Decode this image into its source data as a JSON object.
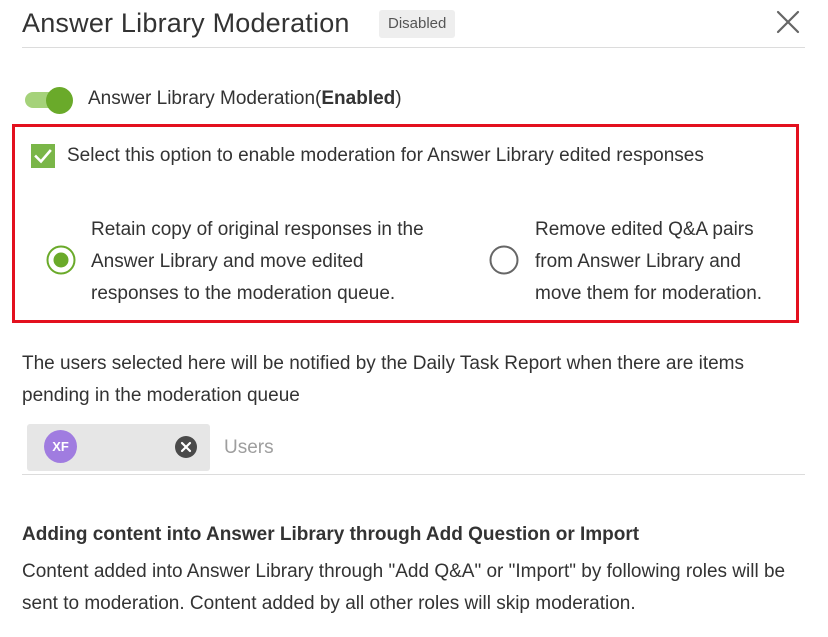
{
  "header": {
    "title": "Answer Library Moderation",
    "status_badge": "Disabled",
    "close_icon": "close-icon"
  },
  "moderation_toggle": {
    "label": "Answer Library Moderation",
    "state_prefix": "(",
    "state": "Enabled",
    "state_suffix": ")",
    "on": true
  },
  "edit_moderation": {
    "checkbox_label": "Select this option to enable moderation for Answer Library edited responses",
    "checked": true,
    "options": [
      {
        "lines": [
          "Retain copy of original responses in the",
          "Answer Library and move edited",
          "responses to the moderation queue."
        ],
        "selected": true
      },
      {
        "lines": [
          "Remove edited Q&A pairs",
          "from Answer Library and",
          "move them for moderation."
        ],
        "selected": false
      }
    ]
  },
  "notify": {
    "description": "The users selected here will be notified by the Daily Task Report when there are items pending in the moderation queue",
    "selected_users": [
      {
        "initials": "XF"
      }
    ],
    "placeholder": "Users"
  },
  "add_content": {
    "heading": "Adding content into Answer Library through Add Question or Import",
    "body": "Content added into Answer Library through \"Add Q&A\" or \"Import\" by following roles will be sent to moderation. Content added by all other roles will skip moderation."
  },
  "colors": {
    "accent_green": "#6aaa2a",
    "checkbox_green": "#7ab648",
    "highlight_red": "#e3101e",
    "avatar_purple": "#a07ce0"
  }
}
